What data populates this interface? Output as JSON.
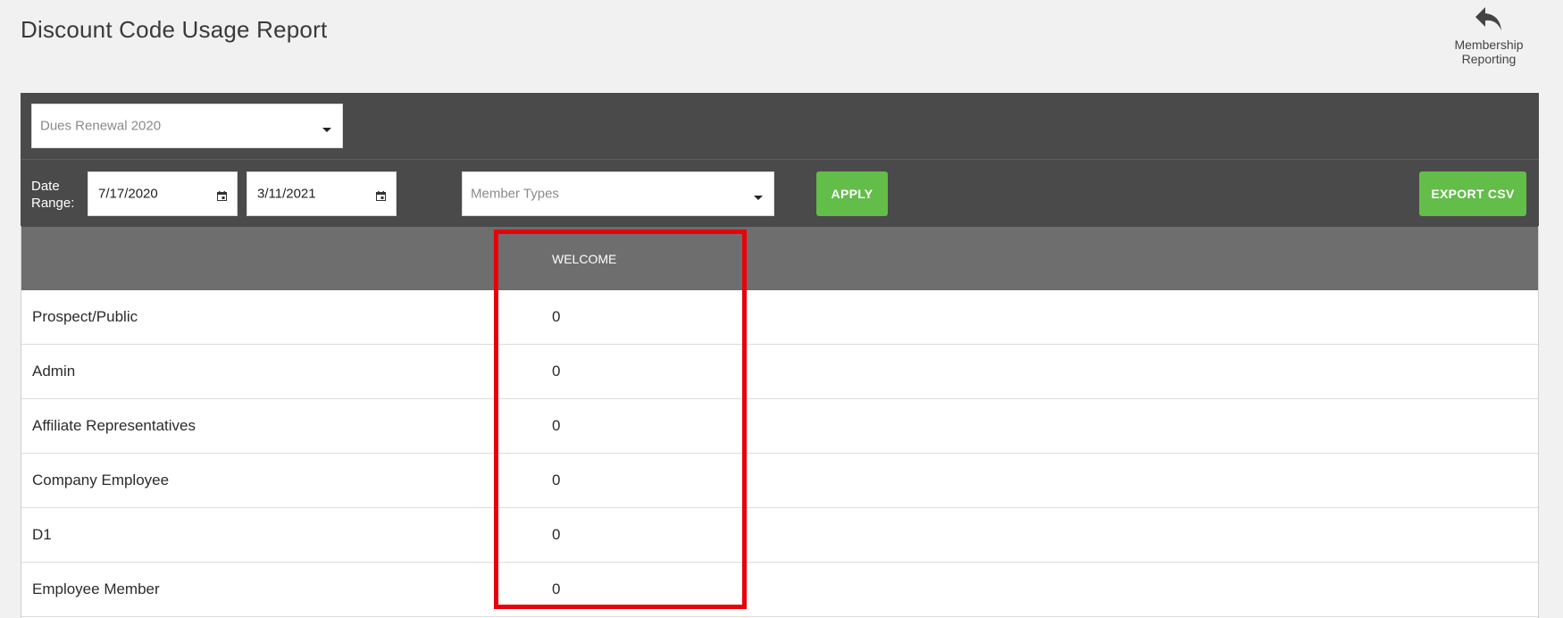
{
  "header": {
    "title": "Discount Code Usage Report",
    "back_link_label": "Membership\nReporting",
    "back_icon": "undo-arrow-icon"
  },
  "filters": {
    "campaign_select_value": "Dues Renewal 2020",
    "date_range_label": "Date\nRange:",
    "start_date": "7/17/2020",
    "end_date": "3/11/2021",
    "member_types_placeholder": "Member Types",
    "apply_label": "APPLY",
    "export_label": "EXPORT CSV"
  },
  "table": {
    "columns": [
      "",
      "WELCOME"
    ],
    "rows": [
      {
        "type": "Prospect/Public",
        "value": "0"
      },
      {
        "type": "Admin",
        "value": "0"
      },
      {
        "type": "Affiliate Representatives",
        "value": "0"
      },
      {
        "type": "Company Employee",
        "value": "0"
      },
      {
        "type": "D1",
        "value": "0"
      },
      {
        "type": "Employee Member",
        "value": "0"
      }
    ]
  },
  "colors": {
    "toolbar_bg": "#4a4a4a",
    "table_header_bg": "#6e6e6e",
    "button_green": "#62bd49",
    "highlight_red": "#e8000b"
  }
}
